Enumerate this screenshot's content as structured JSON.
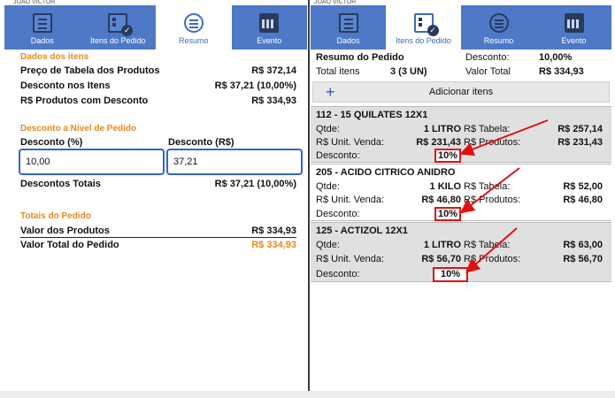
{
  "left": {
    "status_text": "JOAO VICTOR",
    "nav": [
      {
        "label": "Dados",
        "icon": "document-icon"
      },
      {
        "label": "Itens do Pedido",
        "icon": "checklist-icon"
      },
      {
        "label": "Resumo",
        "icon": "summary-icon"
      },
      {
        "label": "Evento",
        "icon": "calendar-icon"
      }
    ],
    "items_section": "Dados dos itens",
    "preco_label": "Preço de Tabela dos Produtos",
    "preco_value": "R$ 372,14",
    "desc_itens_label": "Desconto nos Itens",
    "desc_itens_value": "R$ 37,21 (10,00%)",
    "produtos_desc_label": "R$ Produtos com Desconto",
    "produtos_desc_value": "R$ 334,93",
    "desc_section": "Desconto a Nível de Pedido",
    "desc_pct_label": "Desconto (%)",
    "desc_rs_label": "Desconto (R$)",
    "desc_pct_value": "10,00",
    "desc_rs_value": "37,21",
    "desc_totais_label": "Descontos Totais",
    "desc_totais_value": "R$ 37,21 (10,00%)",
    "totais_section": "Totais do Pedido",
    "valor_produtos_label": "Valor dos Produtos",
    "valor_produtos_value": "R$ 334,93",
    "valor_total_label": "Valor Total do Pedido",
    "valor_total_value": "R$ 334,93"
  },
  "right": {
    "status_text": "JOAO VICTOR",
    "nav": [
      {
        "label": "Dados",
        "icon": "document-icon"
      },
      {
        "label": "Itens do Pedido",
        "icon": "checklist-icon"
      },
      {
        "label": "Resumo",
        "icon": "summary-icon"
      },
      {
        "label": "Evento",
        "icon": "calendar-icon"
      }
    ],
    "resumo_label": "Resumo do Pedido",
    "desconto_label": "Desconto:",
    "desconto_value": "10,00%",
    "total_itens_label": "Total itens",
    "total_itens_value": "3 (3 UN)",
    "valor_total_label": "Valor Total",
    "valor_total_value": "R$ 334,93",
    "add_icon": "+",
    "add_label": "Adicionar itens",
    "items": [
      {
        "title": "112 - 15 QUILATES 12X1",
        "qtde_label": "Qtde:",
        "qtde": "1 LITRO",
        "tabela_label": "R$ Tabela:",
        "tabela": "R$ 257,14",
        "unit_label": "R$ Unit. Venda:",
        "unit": "R$ 231,43",
        "produtos_label": "R$ Produtos:",
        "produtos": "R$ 231,43",
        "desconto_label": "Desconto:",
        "desconto": "10%"
      },
      {
        "title": "205 - ACIDO CITRICO ANIDRO",
        "qtde_label": "Qtde:",
        "qtde": "1 KILO",
        "tabela_label": "R$ Tabela:",
        "tabela": "R$ 52,00",
        "unit_label": "R$ Unit. Venda:",
        "unit": "R$ 46,80",
        "produtos_label": "R$ Produtos:",
        "produtos": "R$ 46,80",
        "desconto_label": "Desconto:",
        "desconto": "10%"
      },
      {
        "title": "125 - ACTIZOL 12X1",
        "qtde_label": "Qtde:",
        "qtde": "1 LITRO",
        "tabela_label": "R$ Tabela:",
        "tabela": "R$ 63,00",
        "unit_label": "R$ Unit. Venda:",
        "unit": "R$ 56,70",
        "produtos_label": "R$ Produtos:",
        "produtos": "R$ 56,70",
        "desconto_label": "Desconto:",
        "desconto": "10%"
      }
    ]
  },
  "colors": {
    "nav_blue": "#4d79c7",
    "orange_heading": "#e58a1f",
    "input_border": "#3465c9",
    "annotation_red": "#e01010",
    "card_gray": "#e0e0e0"
  }
}
